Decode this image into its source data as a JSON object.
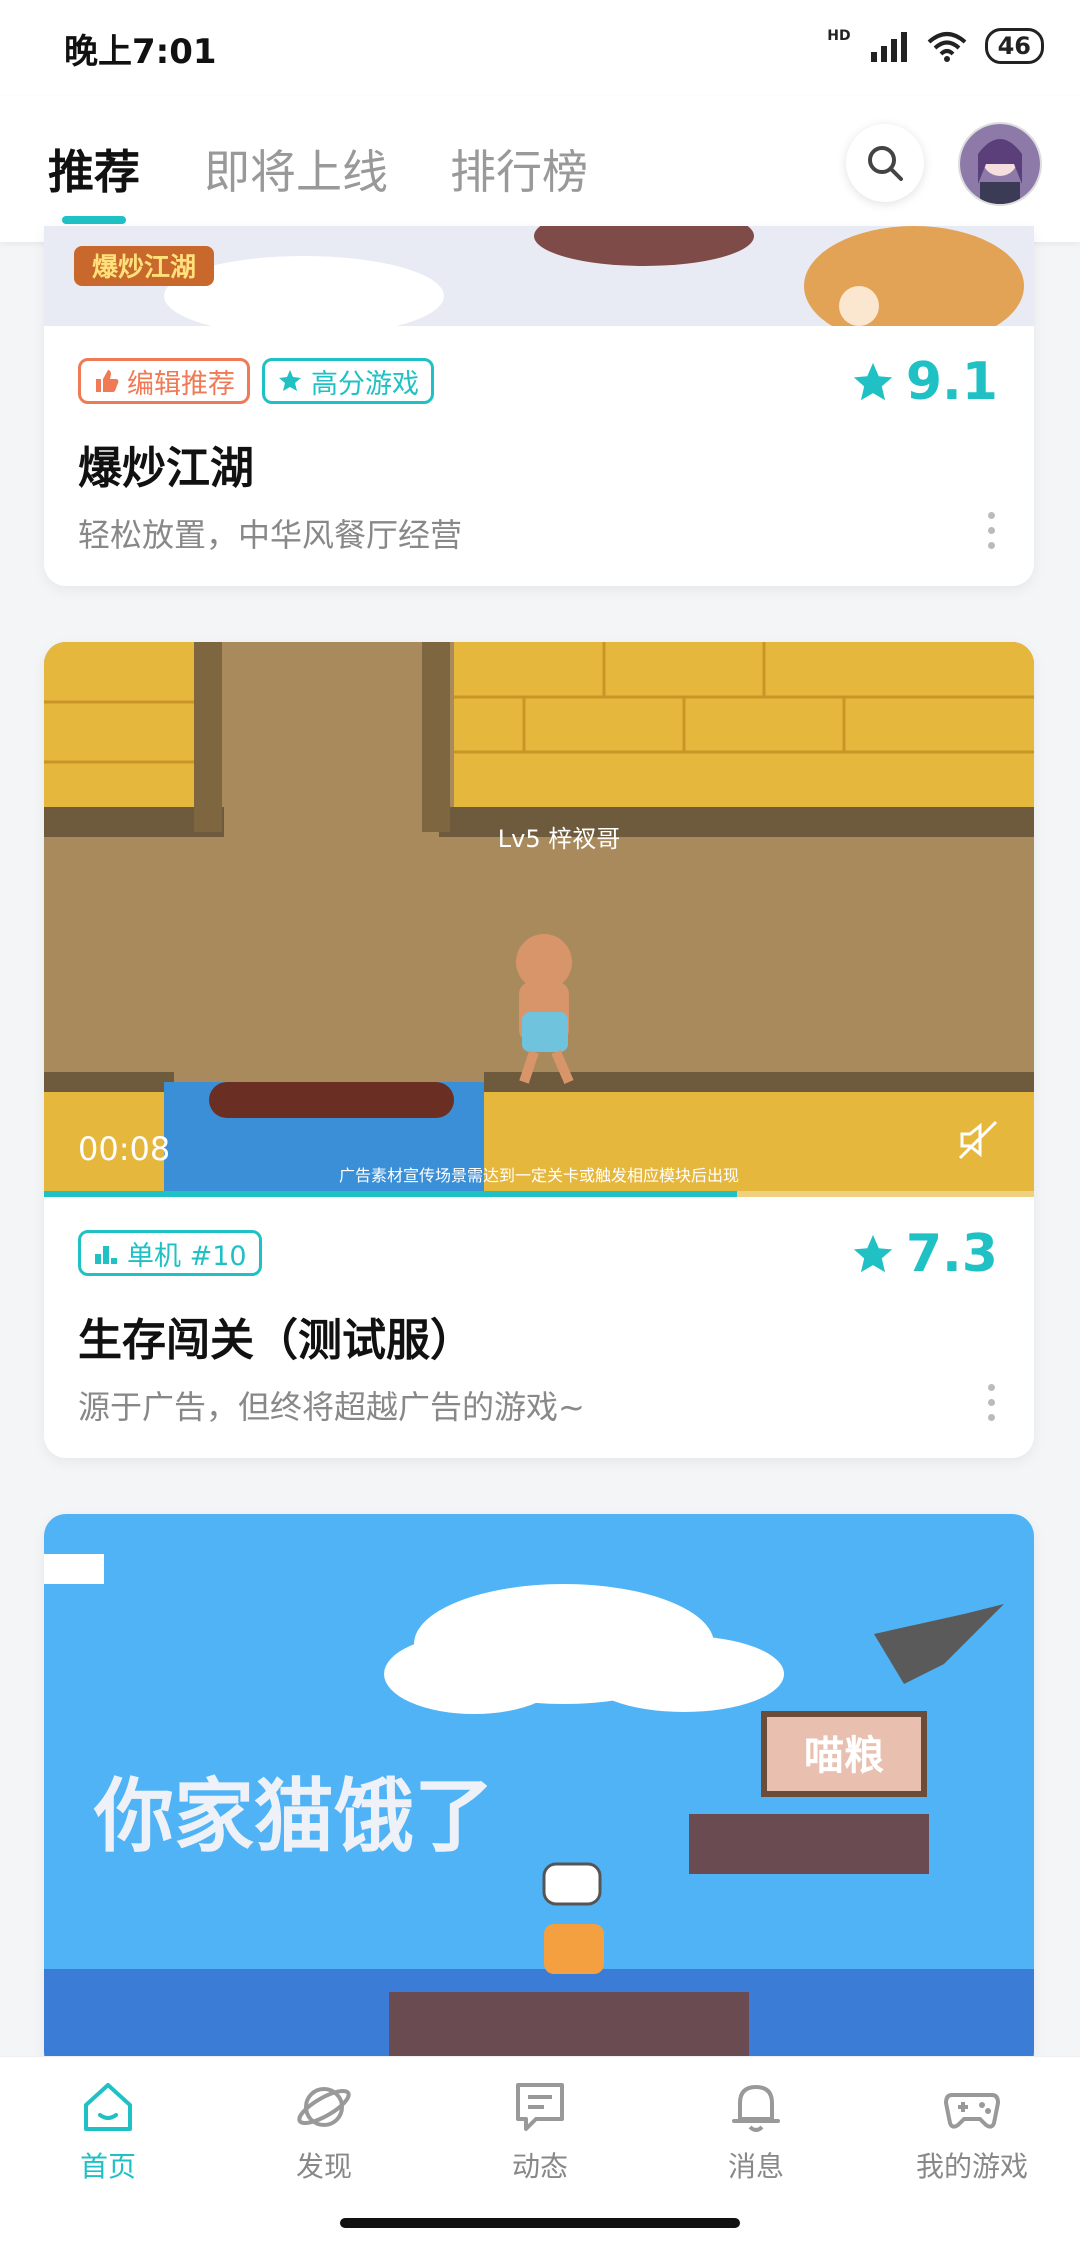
{
  "status_bar": {
    "time": "晚上7:01",
    "network": "HD",
    "battery": "46"
  },
  "tabs": [
    {
      "label": "推荐",
      "active": true
    },
    {
      "label": "即将上线",
      "active": false
    },
    {
      "label": "排行榜",
      "active": false
    }
  ],
  "colors": {
    "accent": "#1fc1c4",
    "editor_badge": "#f07a55"
  },
  "cards": [
    {
      "badges": [
        "编辑推荐",
        "高分游戏"
      ],
      "rating": "9.1",
      "title": "爆炒江湖",
      "description": "轻松放置，中华风餐厅经营",
      "banner_logo_text": "爆炒江湖"
    },
    {
      "badges": [
        "单机 #10"
      ],
      "rating": "7.3",
      "title": "生存闯关（测试服）",
      "description": "源于广告，但终将超越广告的游戏~",
      "video_time": "00:08",
      "video_caption": "广告素材宣传场景需达到一定关卡或触发相应模块后出现",
      "player_label": "Lv5 梓衩哥",
      "video_progress": 0.7
    },
    {
      "scene_text": "你家猫饿了",
      "sign_text": "喵粮"
    }
  ],
  "bottom_nav": [
    {
      "label": "首页",
      "icon": "home-icon",
      "active": true
    },
    {
      "label": "发现",
      "icon": "planet-icon",
      "active": false
    },
    {
      "label": "动态",
      "icon": "chat-icon",
      "active": false
    },
    {
      "label": "消息",
      "icon": "bell-icon",
      "active": false
    },
    {
      "label": "我的游戏",
      "icon": "gamepad-icon",
      "active": false
    }
  ]
}
